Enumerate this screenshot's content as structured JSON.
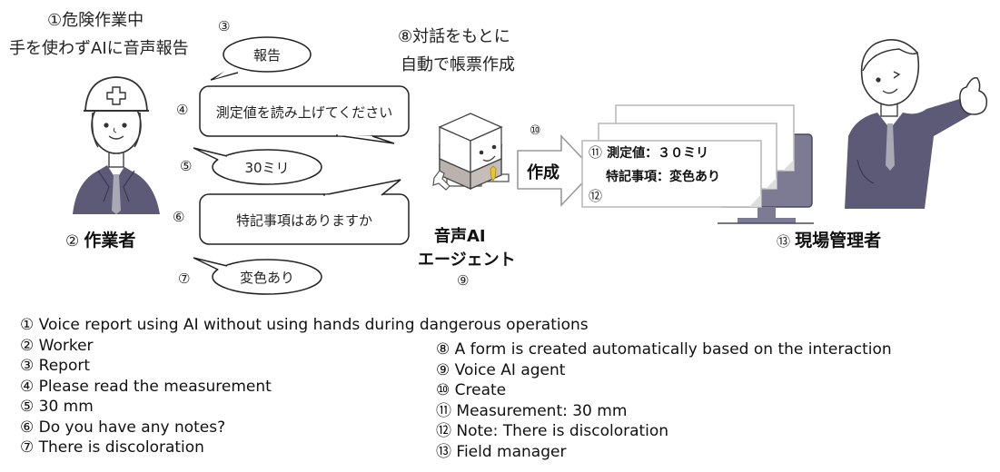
{
  "header": {
    "worker_caption_num": "①",
    "worker_caption_line1": "危険作業中",
    "worker_caption_line2": "手を使わずAIに音声報告",
    "form_caption_num": "⑧",
    "form_caption_line1": "対話をもとに",
    "form_caption_line2": "自動で帳票作成"
  },
  "worker": {
    "num": "②",
    "label": "作業者",
    "icon": "worker-with-helmet-icon"
  },
  "agent": {
    "label_line1": "音声AI",
    "label_line2": "エージェント",
    "num": "⑨",
    "icon": "robot-agent-icon"
  },
  "manager": {
    "num": "⑬",
    "label": "現場管理者",
    "icon": "manager-thumbs-up-icon"
  },
  "dialogue": [
    {
      "num": "③",
      "text": "報告",
      "speaker": "worker",
      "shape": "oval"
    },
    {
      "num": "④",
      "text": "測定値を読み上げてください",
      "speaker": "agent",
      "shape": "rect"
    },
    {
      "num": "⑤",
      "text": "30ミリ",
      "speaker": "worker",
      "shape": "oval"
    },
    {
      "num": "⑥",
      "text": "特記事項はありますか",
      "speaker": "agent",
      "shape": "rect"
    },
    {
      "num": "⑦",
      "text": "変色あり",
      "speaker": "worker",
      "shape": "oval"
    }
  ],
  "create_arrow": {
    "num": "⑩",
    "label": "作成"
  },
  "form": {
    "line1_num": "⑪",
    "line1": "測定値：３０ミリ",
    "line2": "特記事項：変色あり",
    "line2_num": "⑫"
  },
  "legend": {
    "left": [
      "① Voice report using AI without using hands during dangerous operations",
      "② Worker",
      "③ Report",
      "④ Please read the measurement",
      "⑤ 30 mm",
      "⑥ Do you have any notes?",
      "⑦ There is discoloration"
    ],
    "right": [
      "⑧ A form is created automatically based on the interaction",
      "⑨ Voice AI agent",
      "⑩ Create",
      "⑪ Measurement: 30 mm",
      "⑫ Note: There is discoloration",
      "⑬ Field manager"
    ]
  },
  "colors": {
    "suit": "#5d5a78",
    "tie": "#a9a8b5",
    "robot_body": "#b9b2ae",
    "robot_tie": "#e8c631",
    "monitor": "#7d7a93",
    "outline": "#333333"
  }
}
